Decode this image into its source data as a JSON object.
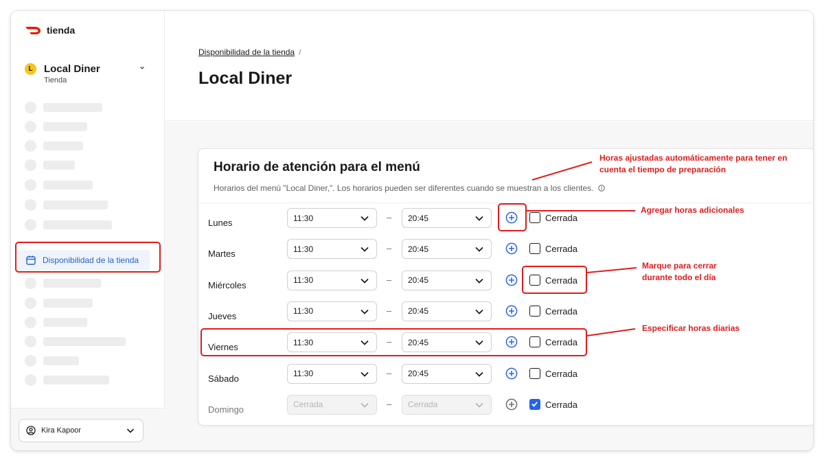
{
  "brand": {
    "name": "tienda",
    "accent": "#eb1700"
  },
  "store": {
    "initial": "L",
    "name": "Local Diner",
    "subtitle": "Tienda"
  },
  "sidebar": {
    "active_item": "Disponibilidad de la tienda"
  },
  "user": {
    "name": "Kira Kapoor"
  },
  "breadcrumb": {
    "item": "Disponibilidad de la tienda",
    "separator": "/"
  },
  "page_title": "Local Diner",
  "card": {
    "title": "Horario de atención para el menú",
    "subtitle": "Horarios del menú \"Local Diner,\". Los horarios pueden ser diferentes cuando se muestran a los clientes.",
    "closed_label": "Cerrada",
    "dash": "–"
  },
  "schedule": [
    {
      "day": "Lunes",
      "open": "11:30",
      "close": "20:45",
      "closed": false
    },
    {
      "day": "Martes",
      "open": "11:30",
      "close": "20:45",
      "closed": false
    },
    {
      "day": "Miércoles",
      "open": "11:30",
      "close": "20:45",
      "closed": false
    },
    {
      "day": "Jueves",
      "open": "11:30",
      "close": "20:45",
      "closed": false
    },
    {
      "day": "Viernes",
      "open": "11:30",
      "close": "20:45",
      "closed": false
    },
    {
      "day": "Sábado",
      "open": "11:30",
      "close": "20:45",
      "closed": false
    },
    {
      "day": "Domingo",
      "open": "Cerrada",
      "close": "Cerrada",
      "closed": true
    }
  ],
  "annotations": {
    "prep_time": "Horas ajustadas automáticamente para tener en cuenta el tiempo de preparación",
    "add_hours": "Agregar horas adicionales",
    "close_all_day": "Marque para cerrar durante todo el día",
    "daily_hours": "Especificar horas diarias"
  },
  "colors": {
    "annotation": "#e01b1b",
    "link_blue": "#2563c9",
    "check_blue": "#2563eb"
  }
}
